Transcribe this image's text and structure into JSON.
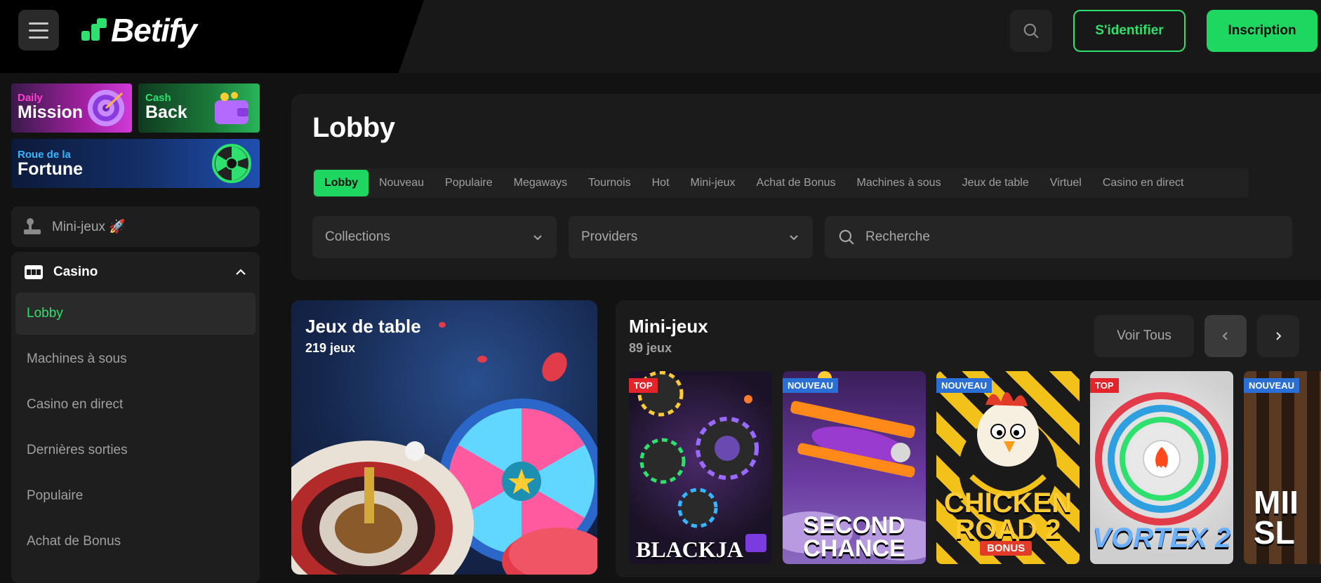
{
  "header": {
    "logo_text": "Betify",
    "login_label": "S'identifier",
    "signup_label": "Inscription",
    "accent": "#1ed760"
  },
  "sidebar": {
    "promos": {
      "daily_small": "Daily",
      "daily_big": "Mission",
      "cash_small": "Cash",
      "cash_big": "Back",
      "wheel_small": "Roue de la",
      "wheel_big": "Fortune"
    },
    "mini_label": "Mini-jeux 🚀",
    "casino_label": "Casino",
    "nav": [
      {
        "label": "Lobby"
      },
      {
        "label": "Machines à sous"
      },
      {
        "label": "Casino en direct"
      },
      {
        "label": "Dernières sorties"
      },
      {
        "label": "Populaire"
      },
      {
        "label": "Achat de Bonus"
      }
    ]
  },
  "main": {
    "title": "Lobby",
    "tabs": [
      {
        "label": "Lobby"
      },
      {
        "label": "Nouveau"
      },
      {
        "label": "Populaire"
      },
      {
        "label": "Megaways"
      },
      {
        "label": "Tournois"
      },
      {
        "label": "Hot"
      },
      {
        "label": "Mini-jeux"
      },
      {
        "label": "Achat de Bonus"
      },
      {
        "label": "Machines à sous"
      },
      {
        "label": "Jeux de table"
      },
      {
        "label": "Virtuel"
      },
      {
        "label": "Casino en direct"
      }
    ],
    "filters": {
      "collections": "Collections",
      "providers": "Providers",
      "search_placeholder": "Recherche"
    }
  },
  "table_card": {
    "title": "Jeux de table",
    "count": "219 jeux"
  },
  "mini_section": {
    "title": "Mini-jeux",
    "count": "89 jeux",
    "see_all": "Voir Tous",
    "games": [
      {
        "badge": "TOP",
        "name": "BLACKJA"
      },
      {
        "badge": "NOUVEAU",
        "name": "SECOND CHANCE"
      },
      {
        "badge": "NOUVEAU",
        "name": "CHICKEN ROAD 2",
        "sub": "BONUS"
      },
      {
        "badge": "TOP",
        "name": "VORTEX 2"
      },
      {
        "badge": "NOUVEAU",
        "name": "MII SL"
      }
    ]
  }
}
